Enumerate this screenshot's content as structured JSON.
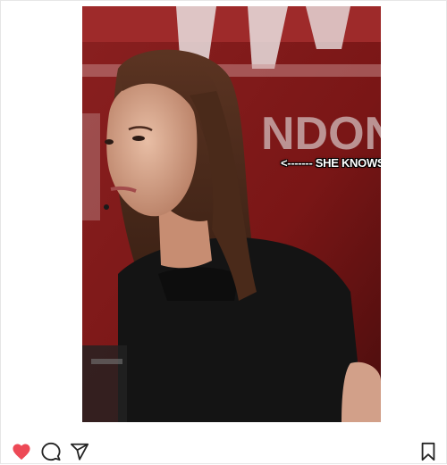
{
  "post": {
    "overlay_text": "<------- SHE KNOWS.",
    "photo_icon": "photo-of-woman-icon"
  },
  "actions": {
    "like_icon": "heart-icon",
    "like_color": "#ed4956",
    "comment_icon": "comment-icon",
    "share_icon": "paper-plane-icon",
    "save_icon": "bookmark-icon"
  }
}
